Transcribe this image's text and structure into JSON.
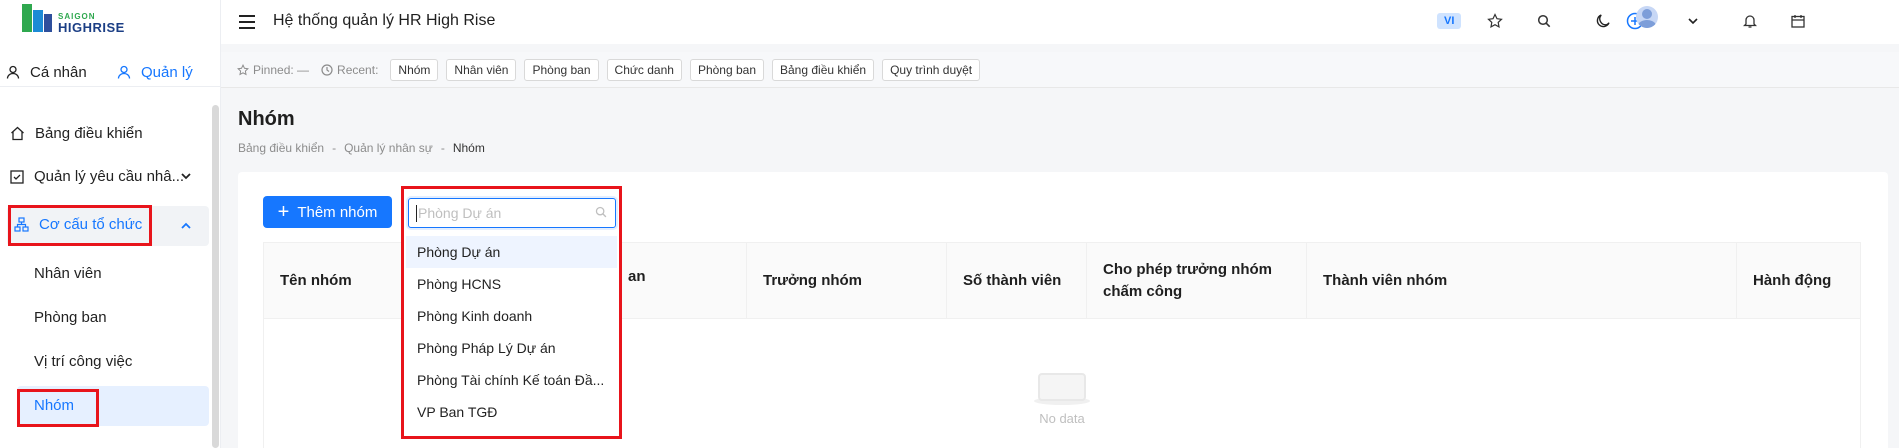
{
  "logo": {
    "line1": "SAIGON",
    "line2": "HIGHRISE"
  },
  "role_tabs": {
    "personal": "Cá nhân",
    "manage": "Quản lý"
  },
  "sidebar": {
    "items": [
      {
        "label": "Bảng điều khiển"
      },
      {
        "label": "Quản lý yêu cầu nhâ..."
      },
      {
        "label": "Cơ cấu tổ chức"
      }
    ],
    "sub_items": [
      {
        "label": "Nhân viên"
      },
      {
        "label": "Phòng ban"
      },
      {
        "label": "Vị trí công việc"
      },
      {
        "label": "Nhóm"
      }
    ]
  },
  "header": {
    "title": "Hệ thống quản lý HR High Rise",
    "lang": "VI"
  },
  "pinbar": {
    "pinned_label": "Pinned:",
    "pinned_value": "—",
    "recent_label": "Recent:",
    "chips": [
      "Nhóm",
      "Nhân viên",
      "Phòng ban",
      "Chức danh",
      "Phòng ban",
      "Bảng điều khiển",
      "Quy trình duyệt"
    ]
  },
  "page": {
    "title": "Nhóm",
    "breadcrumb": [
      "Bảng điều khiển",
      "Quản lý nhân sự",
      "Nhóm"
    ],
    "breadcrumb_sep": "-"
  },
  "toolbar": {
    "add_label": "Thêm nhóm"
  },
  "filter": {
    "placeholder": "Phòng Dự án",
    "options": [
      "Phòng Dự án",
      "Phòng HCNS",
      "Phòng Kinh doanh",
      "Phòng Pháp Lý Dự án",
      "Phòng Tài chính Kế toán Đầ...",
      "VP Ban TGĐ"
    ]
  },
  "table": {
    "columns": [
      "Tên nhóm",
      "an",
      "Trưởng nhóm",
      "Số thành viên",
      "Cho phép trưởng nhóm chấm công",
      "Thành viên nhóm",
      "Hành động"
    ],
    "empty_text": "No data"
  },
  "colors": {
    "accent": "#1677ff",
    "highlight_box": "#e8141b"
  }
}
